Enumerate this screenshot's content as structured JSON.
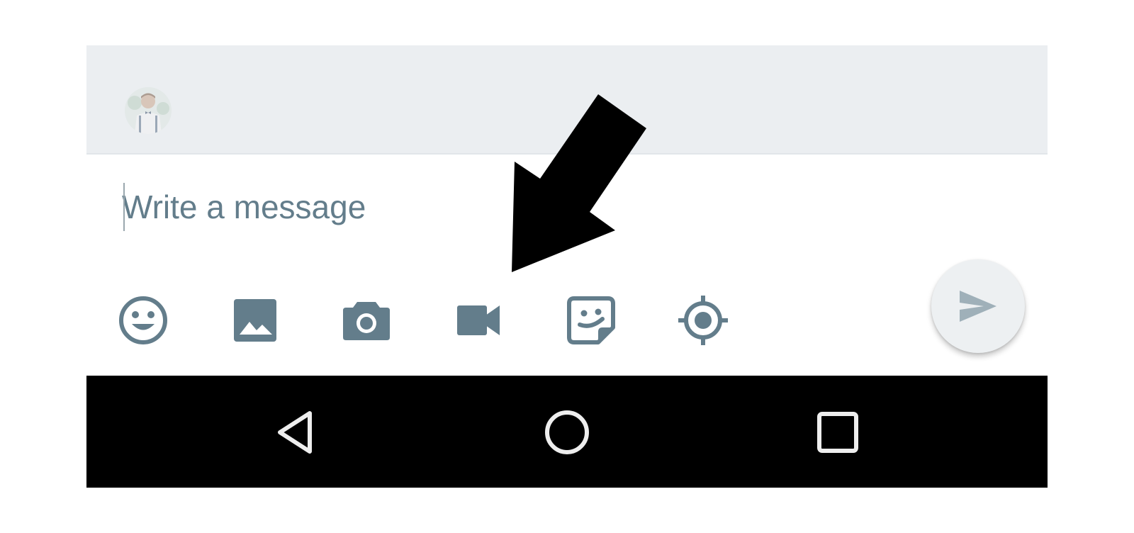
{
  "compose": {
    "message_placeholder": "Write a message",
    "message_value": ""
  },
  "toolbar": {
    "items": [
      {
        "icon": "emoji-icon",
        "label": "emoji"
      },
      {
        "icon": "image-icon",
        "label": "gallery"
      },
      {
        "icon": "camera-icon",
        "label": "camera"
      },
      {
        "icon": "video-camera-icon",
        "label": "video"
      },
      {
        "icon": "sticker-icon",
        "label": "sticker"
      },
      {
        "icon": "location-icon",
        "label": "location"
      }
    ]
  },
  "send": {
    "icon": "send-icon"
  },
  "navigation": {
    "buttons": [
      {
        "icon": "back-triangle-icon"
      },
      {
        "icon": "home-circle-icon"
      },
      {
        "icon": "recents-square-icon"
      }
    ]
  },
  "colors": {
    "icon_gray": "#637d8b",
    "header_bg": "#ebeef1",
    "send_icon": "#9fb0b9",
    "nav_bar_bg": "#000000",
    "nav_icon": "#eeeeee",
    "arrow": "#000000"
  }
}
